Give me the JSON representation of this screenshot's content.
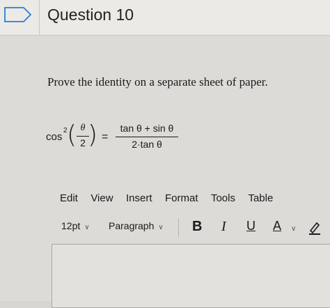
{
  "question": {
    "title": "Question 10",
    "prompt": "Prove the identity on a separate sheet of paper."
  },
  "equation": {
    "lhs_func": "cos",
    "lhs_exponent": "2",
    "lhs_num": "θ",
    "lhs_den": "2",
    "equals": "=",
    "rhs_num": "tan θ + sin θ",
    "rhs_den": "2·tan θ"
  },
  "editor": {
    "menu": [
      "Edit",
      "View",
      "Insert",
      "Format",
      "Tools",
      "Table"
    ],
    "font_size": "12pt",
    "block_format": "Paragraph",
    "bold": "B",
    "italic": "I",
    "underline": "U",
    "text_color": "A"
  }
}
